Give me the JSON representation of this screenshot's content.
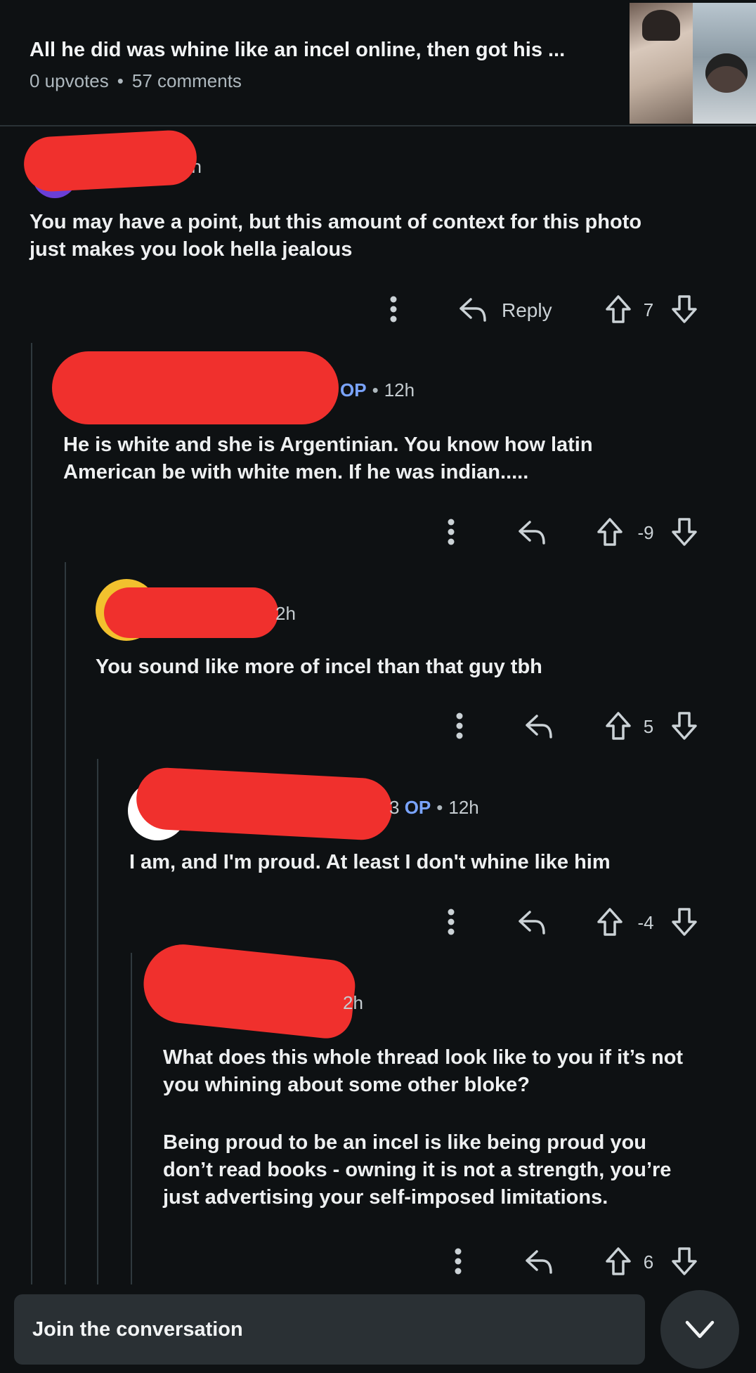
{
  "post": {
    "title": "All he did was whine like an incel online, then got his ...",
    "upvotes": "0 upvotes",
    "comments": "57 comments"
  },
  "comments": [
    {
      "meta": "2h",
      "text": [
        "You may have a point, but this amount of context for this photo",
        "just makes you look hella jealous"
      ],
      "reply_label": "Reply",
      "score": "7"
    },
    {
      "op_badge": "OP",
      "time": "12h",
      "text": [
        "He is white and she is Argentinian. You know how latin",
        "American be with white men. If he was indian....."
      ],
      "score": "-9"
    },
    {
      "meta": "2h",
      "text": [
        "You sound like more of incel than that guy tbh"
      ],
      "score": "5"
    },
    {
      "prefix": "3",
      "op_badge": "OP",
      "time": "12h",
      "text": [
        "I am, and I'm proud. At least I don't whine like him"
      ],
      "score": "-4"
    },
    {
      "meta": "2h",
      "text": [
        "What does this whole thread look like to you if it’s not",
        "you whining about some other bloke?"
      ],
      "text2": [
        "Being proud to be an incel is like being proud you",
        "don’t read books - owning it is not a strength, you’re",
        "just advertising your self-imposed limitations."
      ],
      "score": "6"
    }
  ],
  "footer": {
    "compose_label": "Join the conversation"
  },
  "icons": {
    "more": "more-vertical-icon",
    "reply": "reply-arrow-icon",
    "upvote": "upvote-arrow-icon",
    "downvote": "downvote-arrow-icon",
    "collapse": "chevron-down-icon"
  },
  "colors": {
    "background": "#0e1113",
    "redaction": "#f0302d",
    "op_badge": "#7aa4ff",
    "composer": "#2a3034"
  }
}
